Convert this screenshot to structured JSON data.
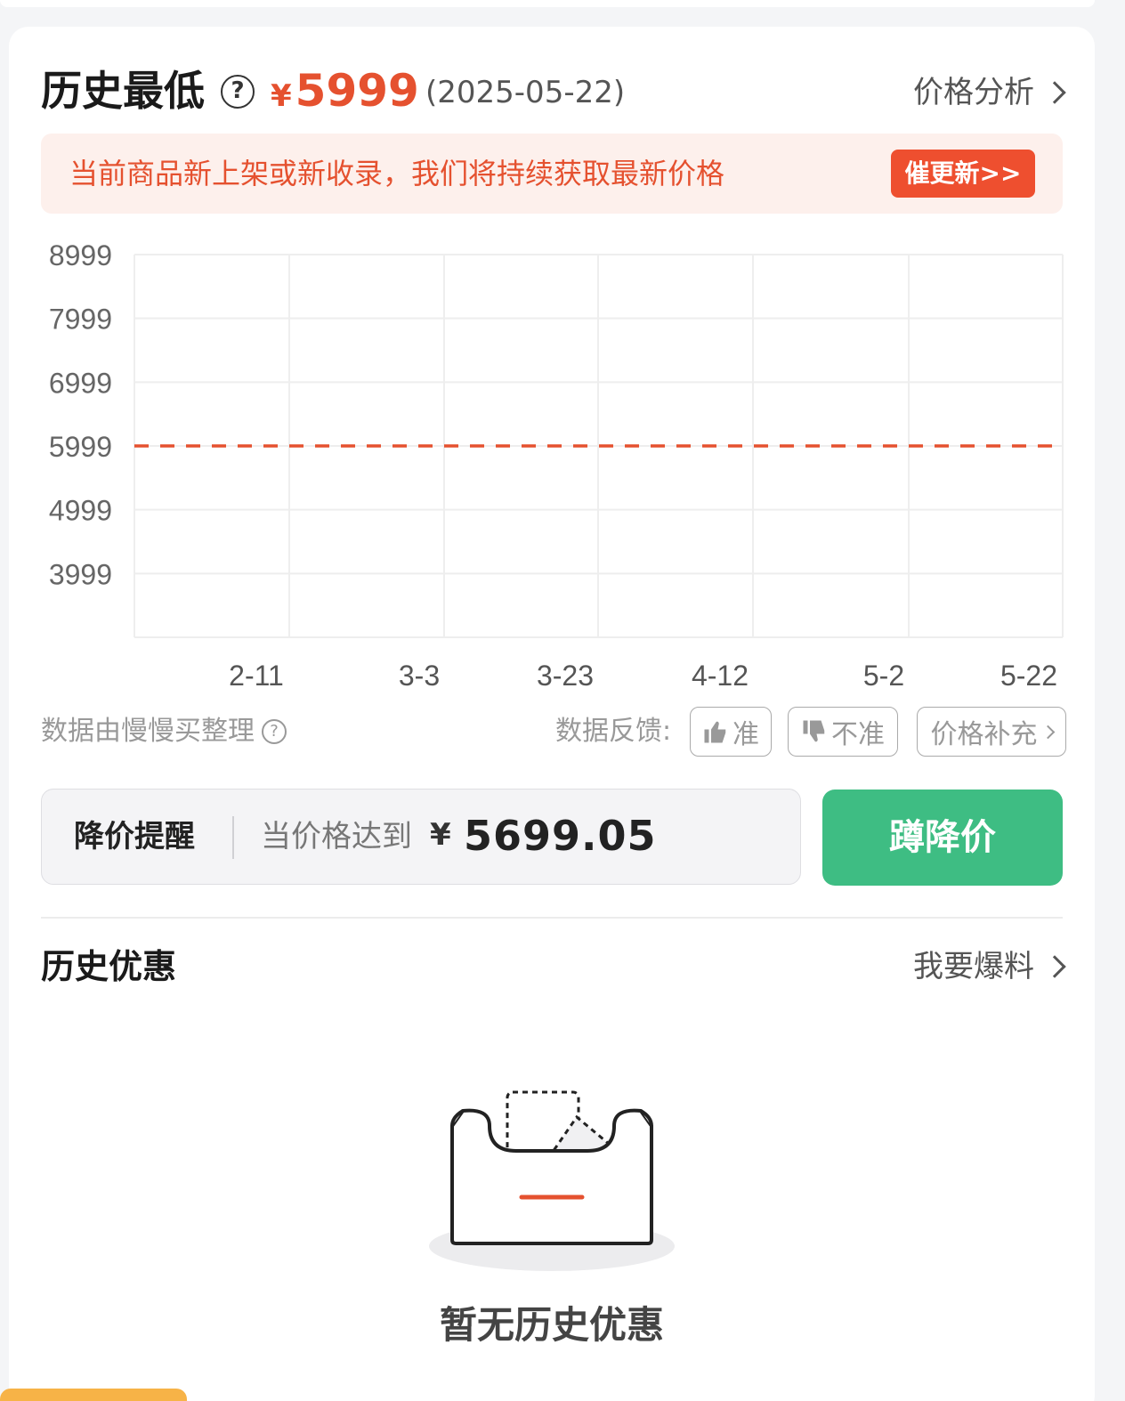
{
  "header": {
    "title": "历史最低",
    "help_glyph": "?",
    "currency": "¥",
    "lowest_price": "5999",
    "lowest_date": "(2025-05-22)",
    "analysis_link": "价格分析"
  },
  "notice": {
    "text": "当前商品新上架或新收录，我们将持续获取最新价格",
    "button": "催更新>>"
  },
  "chart_data": {
    "type": "line",
    "y_ticks": [
      "8999",
      "7999",
      "6999",
      "5999",
      "4999",
      "3999"
    ],
    "ylim": [
      2999,
      8999
    ],
    "x_ticks": [
      "2-11",
      "3-3",
      "3-23",
      "4-12",
      "5-2",
      "5-22"
    ],
    "series": [
      {
        "values": [
          5999,
          5999,
          5999,
          5999,
          5999,
          5999
        ]
      }
    ],
    "line_style": "dashed",
    "line_color": "#e5512f",
    "grid": true
  },
  "source": {
    "text": "数据由慢慢买整理",
    "help_glyph": "?"
  },
  "feedback": {
    "label": "数据反馈:",
    "accurate": "准",
    "inaccurate": "不准",
    "supplement": "价格补充"
  },
  "price_alert": {
    "label": "降价提醒",
    "text": "当价格达到",
    "currency": "¥",
    "target_price": "5699.05",
    "button": "蹲降价"
  },
  "history": {
    "title": "历史优惠",
    "report_link": "我要爆料",
    "empty_text": "暂无历史优惠"
  },
  "colors": {
    "accent_red": "#e5512f",
    "button_green": "#3ebd83",
    "notice_bg": "#fdf0ec"
  }
}
